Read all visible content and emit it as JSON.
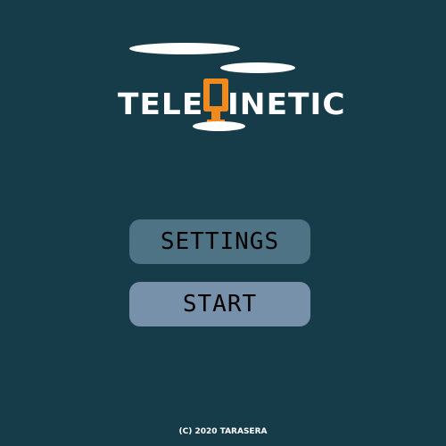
{
  "colors": {
    "background": "#163c49",
    "logo_white": "#ffffff",
    "logo_accent": "#f08a1e",
    "settings_button": "#4d7385",
    "start_button": "#7891aa",
    "button_text": "#000000"
  },
  "logo": {
    "left_text": "TELE",
    "accent_letter": "Q",
    "right_text": "INETIC"
  },
  "menu": {
    "settings_label": "SETTINGS",
    "start_label": "START"
  },
  "footer": {
    "copyright": "(C) 2020 TARASERA"
  }
}
